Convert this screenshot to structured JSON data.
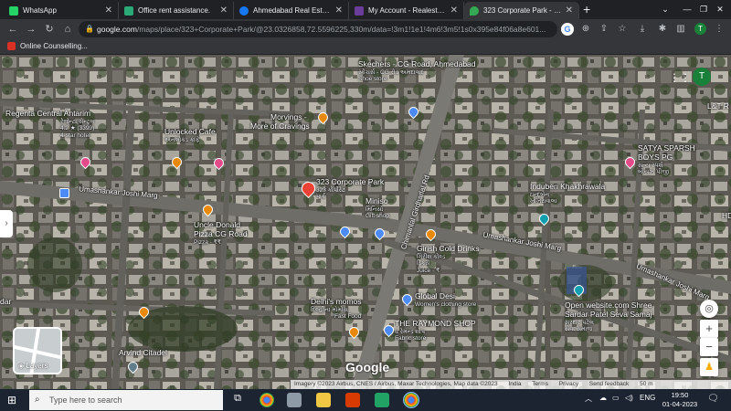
{
  "browser": {
    "tabs": [
      {
        "title": "WhatsApp",
        "color": "#25d366"
      },
      {
        "title": "Office rent assistance.",
        "color": "#2aa876"
      },
      {
        "title": "Ahmedabad Real Estate |",
        "color": "#1877f2"
      },
      {
        "title": "My Account - Realestateli",
        "color": "#6a3d9a"
      },
      {
        "title": "323 Corporate Park - Goo",
        "color": "#34a853",
        "active": true
      }
    ],
    "new_tab": "+",
    "url_host": "google.com",
    "url_path": "/maps/place/323+Corporate+Park/@23.0326858,72.5596225,330m/data=!3m1!1e1!4m6!3m5!1s0x395e84f06a8e601...",
    "profile_initial": "T",
    "bookmark": "Online Counselling..."
  },
  "map": {
    "place_labels": [
      {
        "name": "Skechers - CG Road, Ahmedabad",
        "sub": "સ્કેચર્સ - CG રોડ અમદાવાદ",
        "sub2": "Shoe store"
      },
      {
        "name": "Regenta Central Antarim",
        "sub": "રેજેન્ટા સેન્ટ્રલ",
        "rating": "4.2 ★ (3399)",
        "sub2": "4-star hotel"
      },
      {
        "name": "Unlocked Cafe",
        "sub": "અનલોક્ડ કાફે"
      },
      {
        "name": "Morvings -",
        "name2": "More of Cravings"
      },
      {
        "name": "323 Corporate Park",
        "sub": "323 કોર્પોરેટ",
        "sub2": "પાર્ક"
      },
      {
        "name": "Miniso",
        "sub": "મિનિસો",
        "sub2": "Gift shop"
      },
      {
        "name": "Induben Khakhrawala",
        "sub": "ઇન્દુબેન",
        "sub2": "ખાખરાવાલા"
      },
      {
        "name": "SATYA SPARSH",
        "name2": "BOYS PG",
        "sub": "સત્ય સ્પર્શ",
        "sub2": "બોયઝ પીજી"
      },
      {
        "name": "Uncle Donald",
        "name2": "Pizza CG Road",
        "sub": "Pizza · ₹₹"
      },
      {
        "name": "Girish Cold Drinks",
        "sub": "ગિરીશ કોલ્ડ",
        "sub2": "ડ્રિંક્સ",
        "sub3": "Juice · ₹"
      },
      {
        "name": "Global Desi",
        "sub": "Women's clothing store"
      },
      {
        "name": "Delhi's momos",
        "sub": "દિલ્હીના મોમોસ",
        "sub2": "Fast Food"
      },
      {
        "name": "THE RAYMOND SHOP",
        "sub": "ધ રેમન્ડ શોપ",
        "sub2": "Fabric store"
      },
      {
        "name": "Open website.com Shree",
        "name2": "Sardar Patel Seva Samaj",
        "sub": "સરદાર પટેલ",
        "sub2": "સેવા સમાજ"
      },
      {
        "name": "Arvind Citadel"
      },
      {
        "name": "HD"
      },
      {
        "name": "dar"
      },
      {
        "name": "L&T R"
      }
    ],
    "roads": [
      {
        "name": "Umashankar Joshi Marg"
      },
      {
        "name": "Umashankar Joshi Marg"
      },
      {
        "name": "Umashankar Joshi Marg"
      },
      {
        "name": "Chimanlal Girdharlal Rd"
      }
    ],
    "layers_label": "Layers",
    "google_logo": "Google",
    "attribution": [
      "Imagery ©2023 Airbus, CNES / Airbus, Maxar Technologies, Map data ©2023",
      "India",
      "Terms",
      "Privacy",
      "Send feedback",
      "50 m"
    ],
    "zoom_in": "+",
    "zoom_out": "−",
    "profile_initial": "T"
  },
  "taskbar": {
    "search_placeholder": "Type here to search",
    "language": "ENG",
    "time": "19:50",
    "date": "01-04-2023"
  }
}
